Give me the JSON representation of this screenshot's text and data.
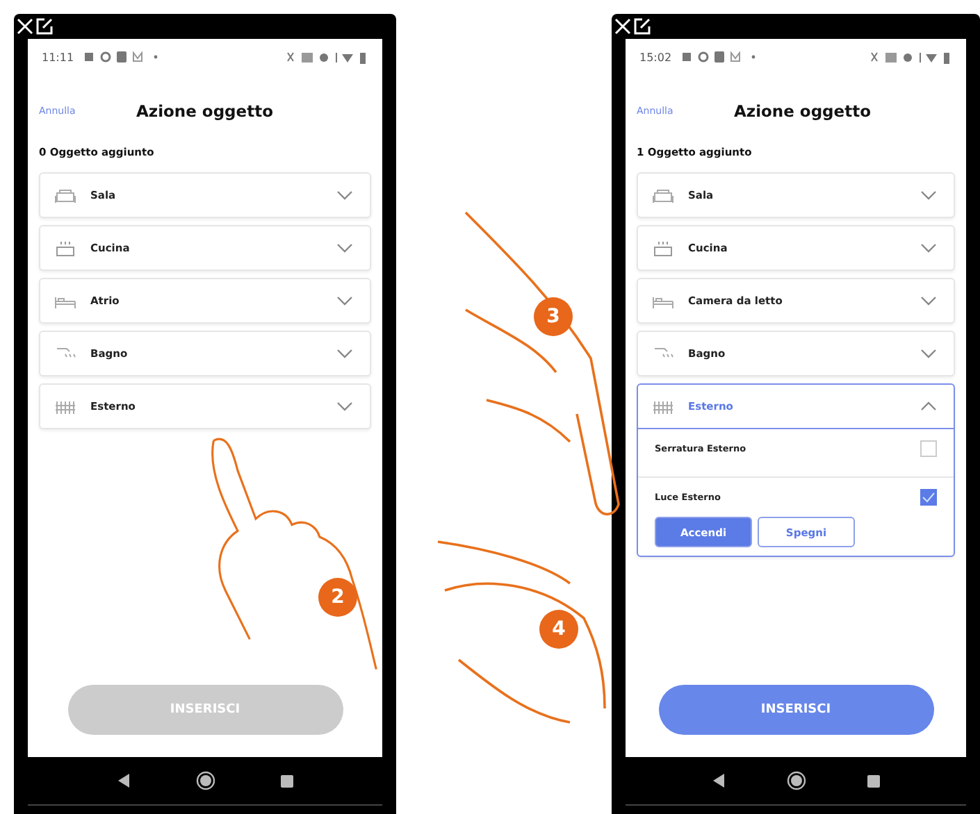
{
  "phones": [
    {
      "status_time": "11:11",
      "cancel": "Annulla",
      "title": "Azione oggetto",
      "count": "0 Oggetto aggiunto",
      "rooms": [
        {
          "name": "Sala",
          "expanded": false
        },
        {
          "name": "Cucina",
          "expanded": false
        },
        {
          "name": "Atrio",
          "expanded": false
        },
        {
          "name": "Bagno",
          "expanded": false
        },
        {
          "name": "Esterno",
          "expanded": false
        }
      ],
      "submit": {
        "label": "INSERISCI",
        "disabled": true
      }
    },
    {
      "status_time": "15:02",
      "cancel": "Annulla",
      "title": "Azione oggetto",
      "count": "1 Oggetto aggiunto",
      "rooms": [
        {
          "name": "Sala",
          "expanded": false
        },
        {
          "name": "Cucina",
          "expanded": false
        },
        {
          "name": "Camera da letto",
          "expanded": false
        },
        {
          "name": "Bagno",
          "expanded": false
        },
        {
          "name": "Esterno",
          "expanded": true,
          "items": [
            {
              "name": "Serratura Esterno",
              "checked": false
            },
            {
              "name": "Luce Esterno",
              "checked": true,
              "actions": [
                {
                  "label": "Accendi",
                  "selected": true
                },
                {
                  "label": "Spegni",
                  "selected": false
                }
              ]
            }
          ]
        }
      ],
      "submit": {
        "label": "INSERISCI",
        "disabled": false
      }
    }
  ],
  "steps": [
    "2",
    "3",
    "4"
  ]
}
